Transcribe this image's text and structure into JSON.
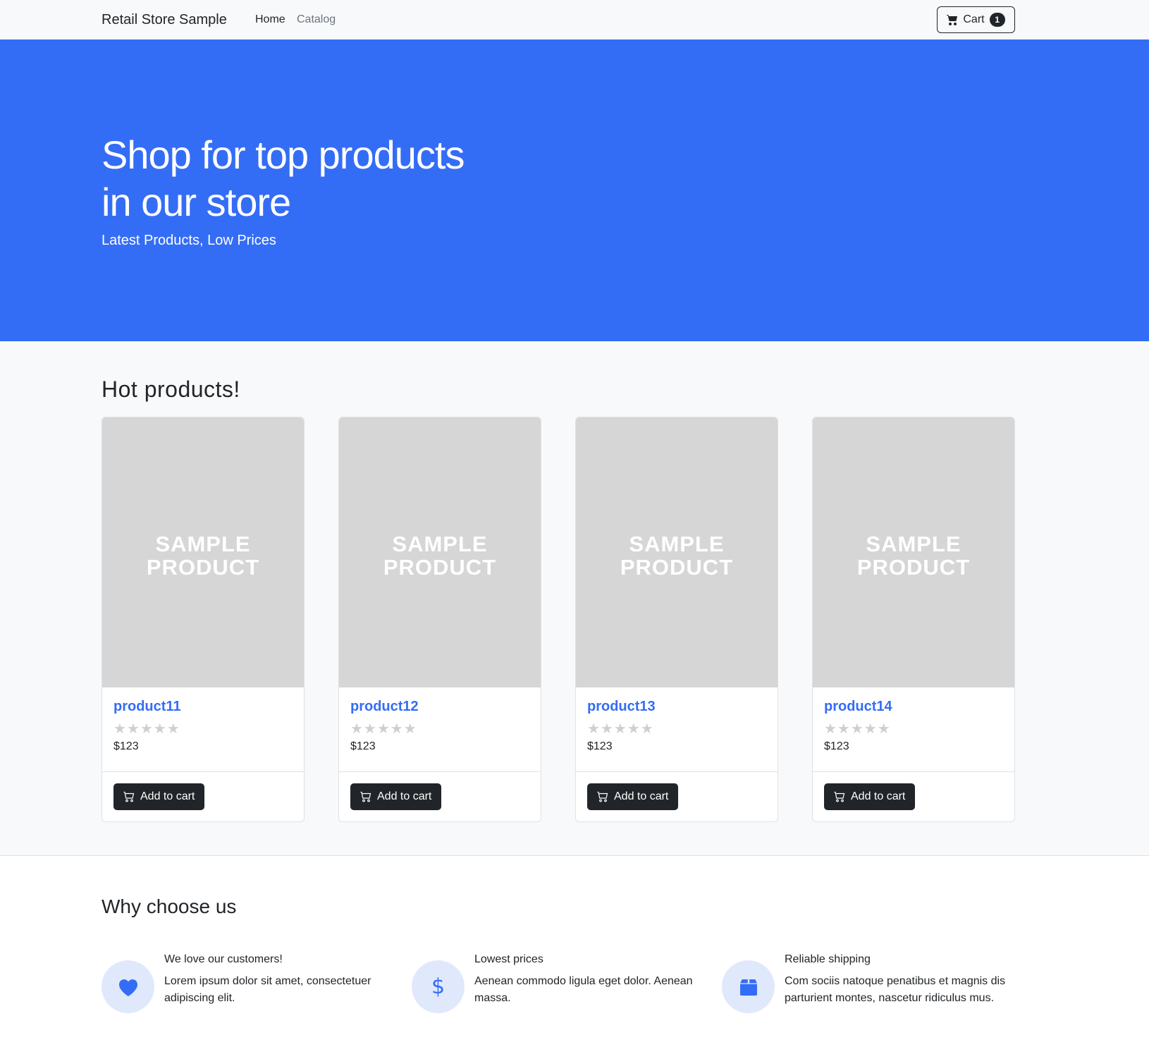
{
  "navbar": {
    "brand": "Retail Store Sample",
    "links": [
      "Home",
      "Catalog"
    ],
    "cart_label": "Cart",
    "cart_count": "1"
  },
  "hero": {
    "title": "Shop for top products in our store",
    "subtitle": "Latest Products, Low Prices",
    "bg_color": "#346df5"
  },
  "hot": {
    "title": "Hot products!",
    "placeholder_text": "SAMPLE PRODUCT",
    "products": [
      {
        "name": "product11",
        "price": "$123",
        "rating": 0,
        "button": "Add to cart"
      },
      {
        "name": "product12",
        "price": "$123",
        "rating": 0,
        "button": "Add to cart"
      },
      {
        "name": "product13",
        "price": "$123",
        "rating": 0,
        "button": "Add to cart"
      },
      {
        "name": "product14",
        "price": "$123",
        "rating": 0,
        "button": "Add to cart"
      }
    ]
  },
  "why": {
    "title": "Why choose us",
    "features": [
      {
        "icon": "heart-icon",
        "title": "We love our customers!",
        "text": "Lorem ipsum dolor sit amet, consectetuer adipiscing elit."
      },
      {
        "icon": "dollar-icon",
        "title": "Lowest prices",
        "text": "Aenean commodo ligula eget dolor. Aenean massa."
      },
      {
        "icon": "box-icon",
        "title": "Reliable shipping",
        "text": "Com sociis natoque penatibus et magnis dis parturient montes, nascetur ridiculus mus."
      }
    ]
  }
}
